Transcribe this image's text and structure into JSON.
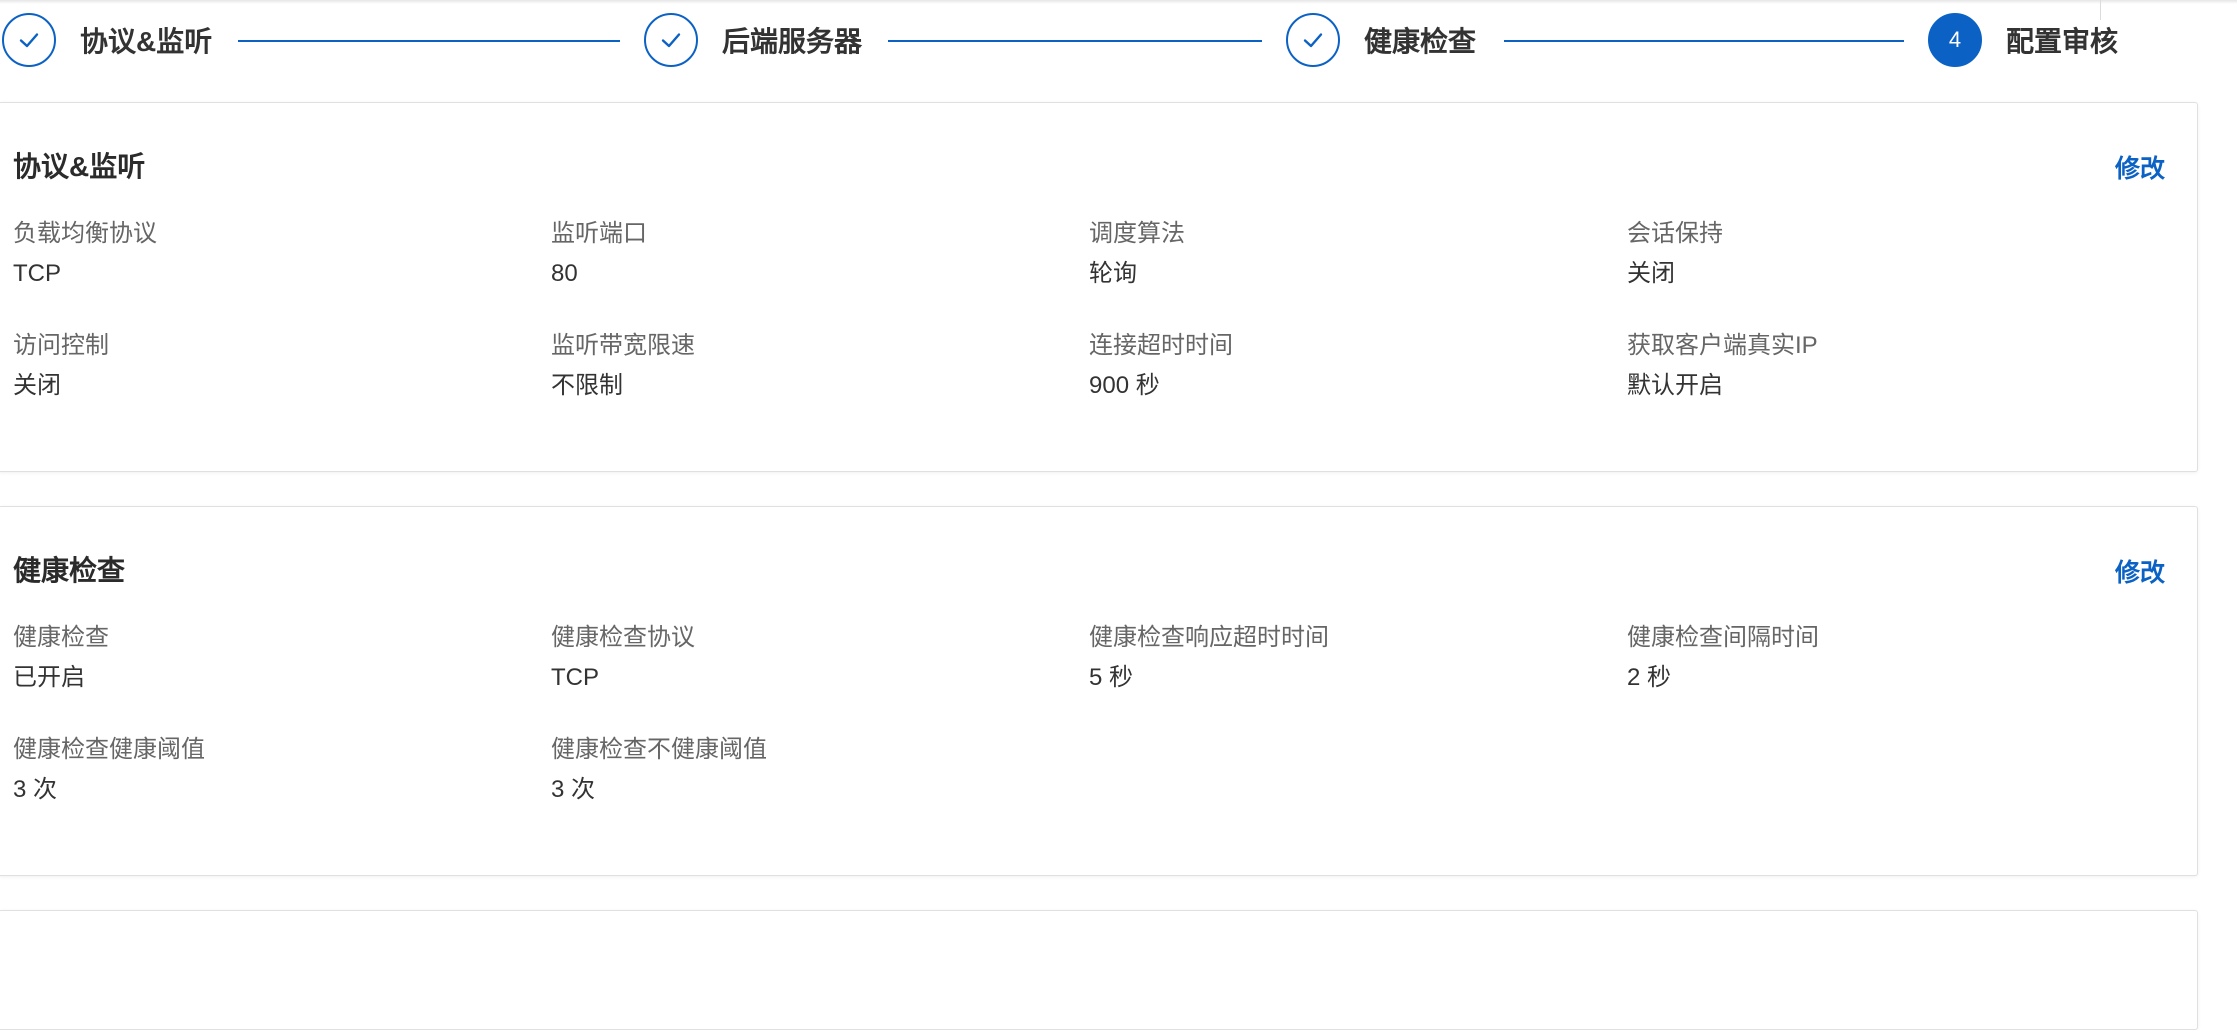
{
  "steps": [
    {
      "label": "协议&监听",
      "state": "done",
      "icon": "check-icon"
    },
    {
      "label": "后端服务器",
      "state": "done",
      "icon": "check-icon"
    },
    {
      "label": "健康检查",
      "state": "done",
      "icon": "check-icon"
    },
    {
      "label": "配置审核",
      "state": "active",
      "number": "4"
    }
  ],
  "sections": {
    "listener": {
      "title": "协议&监听",
      "edit_label": "修改",
      "fields": [
        {
          "label": "负载均衡协议",
          "value": "TCP"
        },
        {
          "label": "监听端口",
          "value": "80"
        },
        {
          "label": "调度算法",
          "value": "轮询"
        },
        {
          "label": "会话保持",
          "value": "关闭"
        },
        {
          "label": "访问控制",
          "value": "关闭"
        },
        {
          "label": "监听带宽限速",
          "value": "不限制"
        },
        {
          "label": "连接超时时间",
          "value": "900 秒"
        },
        {
          "label": "获取客户端真实IP",
          "value": "默认开启"
        }
      ]
    },
    "health": {
      "title": "健康检查",
      "edit_label": "修改",
      "fields": [
        {
          "label": "健康检查",
          "value": "已开启"
        },
        {
          "label": "健康检查协议",
          "value": "TCP"
        },
        {
          "label": "健康检查响应超时时间",
          "value": "5 秒"
        },
        {
          "label": "健康检查间隔时间",
          "value": "2 秒"
        },
        {
          "label": "健康检查健康阈值",
          "value": "3 次"
        },
        {
          "label": "健康检查不健康阈值",
          "value": "3 次"
        }
      ]
    }
  },
  "colors": {
    "accent": "#0b62c4",
    "text": "#333333",
    "muted": "#666666",
    "border": "#e0e0e0"
  }
}
